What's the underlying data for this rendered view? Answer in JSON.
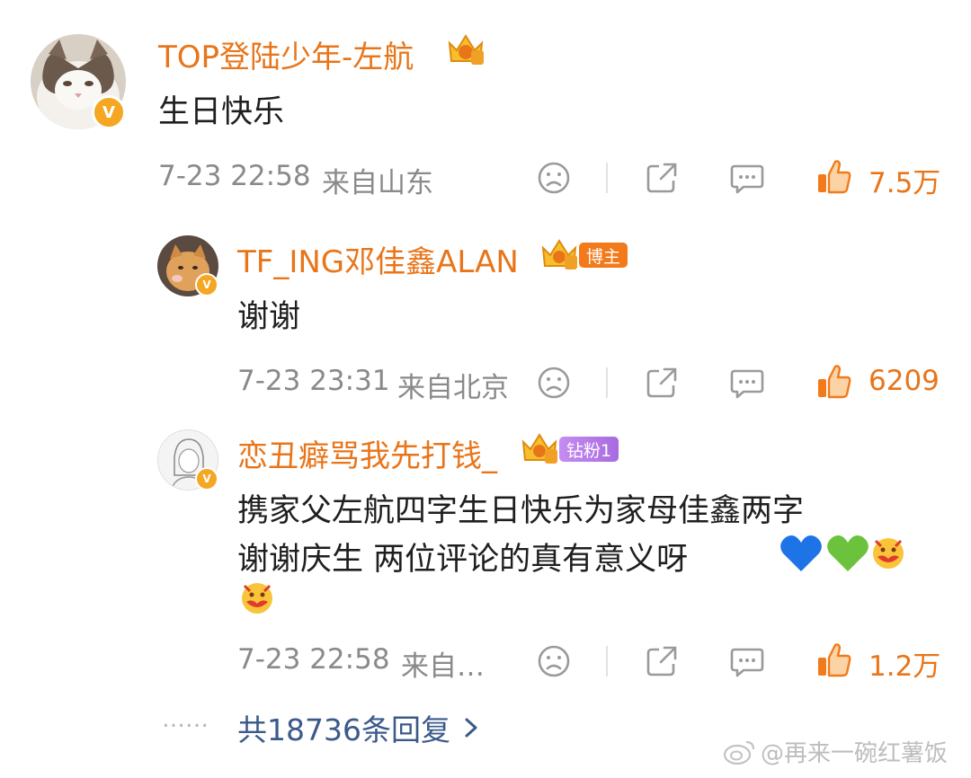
{
  "comments": [
    {
      "username": "TOP登陆少年-左航",
      "text": "生日快乐",
      "time": "7-23 22:58",
      "location": "来自山东",
      "likes": "7.5万"
    },
    {
      "username": "TF_ING邓佳鑫ALAN",
      "tag": "博主",
      "text": "谢谢",
      "time": "7-23 23:31",
      "location": "来自北京",
      "likes": "6209"
    },
    {
      "username": "恋丑癖骂我先打钱_",
      "tag": "钻粉1",
      "text_line1": "携家父左航四字生日快乐为家母佳鑫两字",
      "text_line2": "谢谢庆生 两位评论的真有意义呀",
      "time": "7-23 22:58",
      "location": "来自…",
      "likes": "1.2万"
    }
  ],
  "footer": {
    "dots": "……",
    "replies": "共18736条回复",
    "watermark": "@再来一碗红薯饭"
  },
  "colors": {
    "accent": "#e8751a",
    "meta": "#8a8a8a",
    "icon": "#9a9a9a",
    "badge": "#f5a623"
  },
  "icons": [
    "dislike-face-icon",
    "share-icon",
    "comment-icon",
    "thumbs-up-icon",
    "vip-crown-icon",
    "verified-v-icon",
    "chevron-right-icon",
    "weibo-logo-icon",
    "blue-heart-emoji",
    "green-heart-emoji",
    "love-face-emoji"
  ]
}
